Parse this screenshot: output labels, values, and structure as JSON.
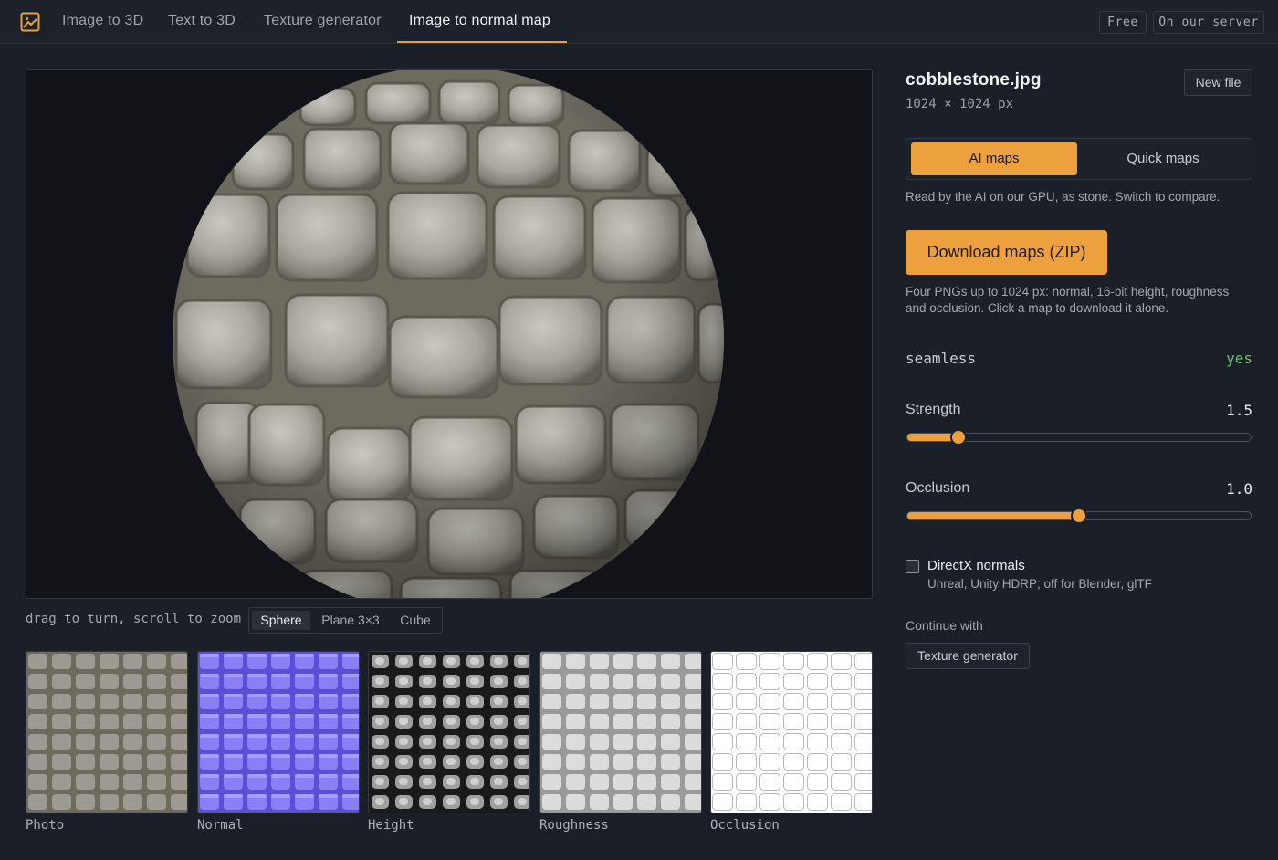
{
  "nav": {
    "tabs": [
      {
        "label": "Image to 3D"
      },
      {
        "label": "Text to 3D"
      },
      {
        "label": "Texture generator"
      },
      {
        "label": "Image to normal map"
      }
    ],
    "active_tab": "Image to normal map",
    "badges": [
      "Free",
      "On our server"
    ],
    "logo_icon": "image-frame-icon"
  },
  "viewer": {
    "hint": "drag to turn, scroll to zoom",
    "shapes": [
      "Sphere",
      "Plane 3×3",
      "Cube"
    ],
    "selected_shape": "Sphere"
  },
  "maps": [
    {
      "label": "Photo"
    },
    {
      "label": "Normal"
    },
    {
      "label": "Height"
    },
    {
      "label": "Roughness"
    },
    {
      "label": "Occlusion"
    }
  ],
  "file": {
    "name": "cobblestone.jpg",
    "dims": "1024 × 1024 px",
    "new_file_label": "New file"
  },
  "mode": {
    "options": [
      "AI maps",
      "Quick maps"
    ],
    "selected": "AI maps",
    "note": "Read by the AI on our GPU, as stone. Switch to compare."
  },
  "download": {
    "label": "Download maps (ZIP)",
    "note_line1": "Four PNGs up to 1024 px: normal, 16-bit height, roughness",
    "note_line2": "and occlusion. Click a map to download it alone."
  },
  "seamless": {
    "label": "seamless",
    "value": "yes"
  },
  "strength": {
    "label": "Strength",
    "value": "1.5",
    "fraction": 0.15
  },
  "occlusion": {
    "label": "Occlusion",
    "value": "1.0",
    "fraction": 0.5
  },
  "directx": {
    "label": "DirectX normals",
    "sub": "Unreal, Unity HDRP; off for Blender, glTF",
    "checked": false
  },
  "continue": {
    "label": "Continue with",
    "button": "Texture generator"
  },
  "colors": {
    "accent": "#eda13e",
    "background": "#1b1f27",
    "success": "#6cbf6a"
  }
}
